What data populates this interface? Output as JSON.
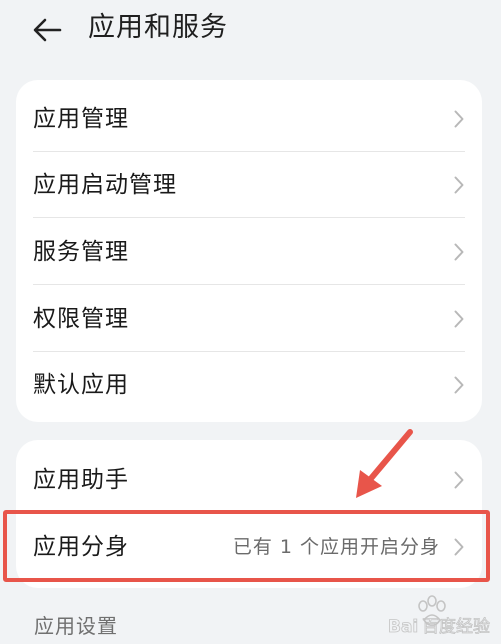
{
  "header": {
    "title": "应用和服务",
    "back_icon": "arrow-left-icon"
  },
  "card1": {
    "items": [
      {
        "label": "应用管理"
      },
      {
        "label": "应用启动管理"
      },
      {
        "label": "服务管理"
      },
      {
        "label": "权限管理"
      },
      {
        "label": "默认应用"
      }
    ]
  },
  "card2": {
    "items": [
      {
        "label": "应用助手"
      },
      {
        "label": "应用分身",
        "value": "已有 1 个应用开启分身"
      }
    ]
  },
  "section": {
    "label": "应用设置"
  },
  "annotation": {
    "highlight_color": "#e8554a",
    "arrow_icon": "arrow-down-left-icon"
  },
  "watermark": {
    "text": "Bai百度经验",
    "icon": "paw-icon"
  },
  "colors": {
    "background": "#f1f3f5",
    "card": "#ffffff",
    "text_primary": "#1a1a1a",
    "text_secondary": "#6b6b6b",
    "chevron": "#b8b8b8"
  }
}
